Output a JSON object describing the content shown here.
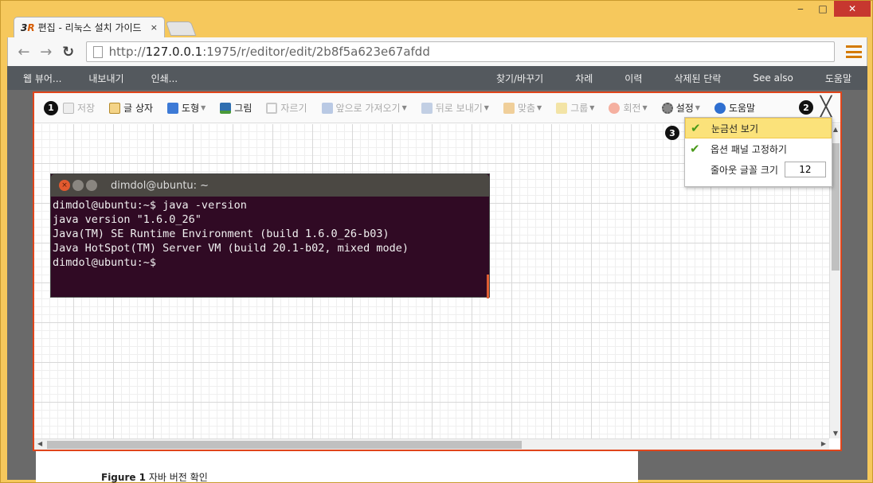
{
  "browser": {
    "tab_logo_left": "3",
    "tab_logo_right": "R",
    "tab_title": "편집 - 리눅스 설치 가이드",
    "tab_close": "×",
    "window_min": "‒",
    "window_max": "□",
    "window_close": "✕",
    "url_prefix": "http://",
    "url_host": "127.0.0.1",
    "url_rest": ":1975/r/editor/edit/2b8f5a623e67afdd"
  },
  "appbar": {
    "left": [
      "웹 뷰어...",
      "내보내기",
      "인쇄..."
    ],
    "right": [
      "찾기/바꾸기",
      "차례",
      "이력",
      "삭제된 단락",
      "See also",
      "도움말"
    ]
  },
  "editor_toolbar": {
    "badge1": "1",
    "badge2": "2",
    "badge3": "3",
    "save": "저장",
    "textbox": "글 상자",
    "shape": "도형",
    "image": "그림",
    "crop": "자르기",
    "bring_front": "앞으로 가져오기",
    "send_back": "뒤로 보내기",
    "align": "맞춤",
    "group": "그룹",
    "rotate": "회전",
    "settings": "설정",
    "help": "도움말",
    "close": "╳"
  },
  "settings_menu": {
    "show_grid": "눈금선 보기",
    "pin_panel": "옵션 패널 고정하기",
    "zoom_font_size_label": "줄아웃 글꼴 크기",
    "zoom_font_size_value": "12"
  },
  "terminal": {
    "title": "dimdol@ubuntu: ~",
    "lines": "dimdol@ubuntu:~$ java -version\njava version \"1.6.0_26\"\nJava(TM) SE Runtime Environment (build 1.6.0_26-b03)\nJava HotSpot(TM) Server VM (build 20.1-b02, mixed mode)\ndimdol@ubuntu:~$"
  },
  "document": {
    "figure_label": "Figure 1",
    "figure_caption": "자바 버전 확인"
  },
  "colors": {
    "window_frame": "#f6c85c",
    "editor_border": "#e0451b",
    "appbar": "#54595e",
    "terminal_bg": "#300a24",
    "highlight": "#fbe27a"
  }
}
